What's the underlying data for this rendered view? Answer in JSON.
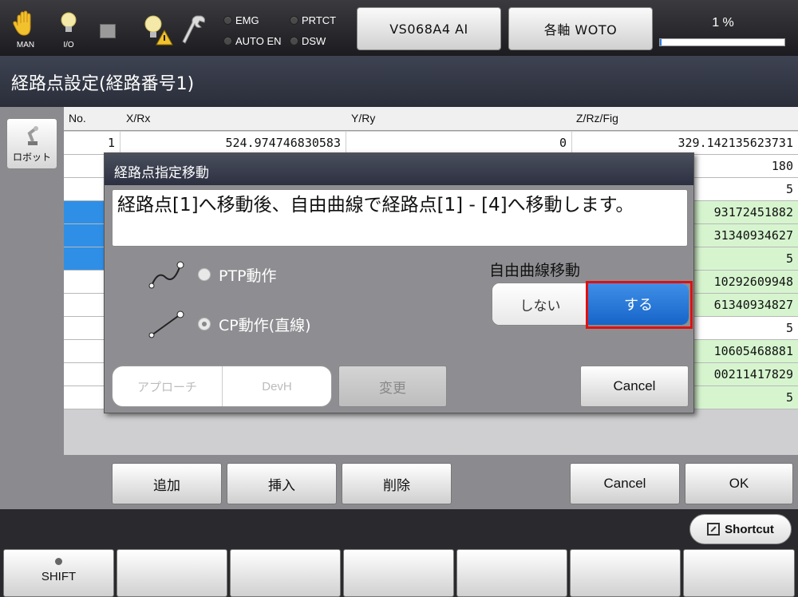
{
  "topbar": {
    "man_label": "MAN",
    "io_label": "I/O",
    "leds": [
      "EMG",
      "PRTCT",
      "AUTO EN",
      "DSW"
    ],
    "model_button": "VS068A4 AI",
    "axis_button": "各軸 WOTO",
    "progress_text": "1 %",
    "progress_percent": 1
  },
  "title": "経路点設定(経路番号1)",
  "left_panel": {
    "robot_button": "ロボット"
  },
  "grid": {
    "columns": [
      "No.",
      "X/Rx",
      "Y/Ry",
      "Z/Rz/Fig"
    ],
    "rows": [
      {
        "no": "1",
        "x": "524.974746830583",
        "y": "0",
        "z": "329.142135623731"
      },
      {
        "no": "",
        "x": "",
        "y": "",
        "z": "180"
      },
      {
        "no": "",
        "x": "",
        "y": "",
        "z": "5"
      },
      {
        "no": "",
        "x": "",
        "y": "",
        "z": "93172451882"
      },
      {
        "no": "",
        "x": "",
        "y": "",
        "z": "31340934627"
      },
      {
        "no": "",
        "x": "",
        "y": "",
        "z": "5"
      },
      {
        "no": "",
        "x": "",
        "y": "",
        "z": "10292609948"
      },
      {
        "no": "",
        "x": "",
        "y": "",
        "z": "61340934827"
      },
      {
        "no": "",
        "x": "",
        "y": "",
        "z": "5"
      },
      {
        "no": "",
        "x": "",
        "y": "",
        "z": "10605468881"
      },
      {
        "no": "",
        "x": "",
        "y": "",
        "z": "00211417829"
      },
      {
        "no": "",
        "x": "",
        "y": "",
        "z": "5"
      }
    ]
  },
  "actions": {
    "add": "追加",
    "insert": "挿入",
    "delete": "削除",
    "cancel": "Cancel",
    "ok": "OK",
    "shortcut": "Shortcut"
  },
  "fkeys": {
    "shift": "SHIFT"
  },
  "dialog": {
    "title": "経路点指定移動",
    "message": "経路点[1]へ移動後、自由曲線で経路点[1] - [4]へ移動します。",
    "ptp_label": "PTP動作",
    "cp_label": "CP動作(直線)",
    "free_curve_label": "自由曲線移動",
    "seg_off": "しない",
    "seg_on": "する",
    "approach": "アプローチ",
    "devh": "DevH",
    "change": "変更",
    "cancel": "Cancel"
  },
  "colors": {
    "accent_blue": "#1f75d8",
    "highlight_red": "#e01010",
    "row_green": "#d6f5cf",
    "row_blue": "#2f8fe6"
  }
}
